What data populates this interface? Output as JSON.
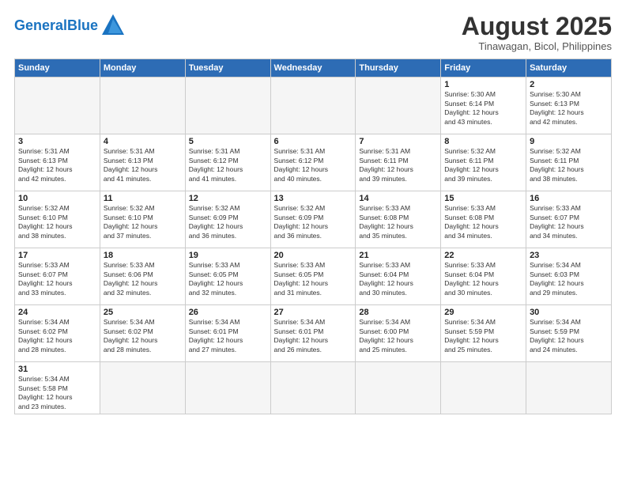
{
  "header": {
    "logo_general": "General",
    "logo_blue": "Blue",
    "cal_title": "August 2025",
    "cal_subtitle": "Tinawagan, Bicol, Philippines"
  },
  "weekdays": [
    "Sunday",
    "Monday",
    "Tuesday",
    "Wednesday",
    "Thursday",
    "Friday",
    "Saturday"
  ],
  "weeks": [
    [
      {
        "day": "",
        "info": ""
      },
      {
        "day": "",
        "info": ""
      },
      {
        "day": "",
        "info": ""
      },
      {
        "day": "",
        "info": ""
      },
      {
        "day": "",
        "info": ""
      },
      {
        "day": "1",
        "info": "Sunrise: 5:30 AM\nSunset: 6:14 PM\nDaylight: 12 hours\nand 43 minutes."
      },
      {
        "day": "2",
        "info": "Sunrise: 5:30 AM\nSunset: 6:13 PM\nDaylight: 12 hours\nand 42 minutes."
      }
    ],
    [
      {
        "day": "3",
        "info": "Sunrise: 5:31 AM\nSunset: 6:13 PM\nDaylight: 12 hours\nand 42 minutes."
      },
      {
        "day": "4",
        "info": "Sunrise: 5:31 AM\nSunset: 6:13 PM\nDaylight: 12 hours\nand 41 minutes."
      },
      {
        "day": "5",
        "info": "Sunrise: 5:31 AM\nSunset: 6:12 PM\nDaylight: 12 hours\nand 41 minutes."
      },
      {
        "day": "6",
        "info": "Sunrise: 5:31 AM\nSunset: 6:12 PM\nDaylight: 12 hours\nand 40 minutes."
      },
      {
        "day": "7",
        "info": "Sunrise: 5:31 AM\nSunset: 6:11 PM\nDaylight: 12 hours\nand 39 minutes."
      },
      {
        "day": "8",
        "info": "Sunrise: 5:32 AM\nSunset: 6:11 PM\nDaylight: 12 hours\nand 39 minutes."
      },
      {
        "day": "9",
        "info": "Sunrise: 5:32 AM\nSunset: 6:11 PM\nDaylight: 12 hours\nand 38 minutes."
      }
    ],
    [
      {
        "day": "10",
        "info": "Sunrise: 5:32 AM\nSunset: 6:10 PM\nDaylight: 12 hours\nand 38 minutes."
      },
      {
        "day": "11",
        "info": "Sunrise: 5:32 AM\nSunset: 6:10 PM\nDaylight: 12 hours\nand 37 minutes."
      },
      {
        "day": "12",
        "info": "Sunrise: 5:32 AM\nSunset: 6:09 PM\nDaylight: 12 hours\nand 36 minutes."
      },
      {
        "day": "13",
        "info": "Sunrise: 5:32 AM\nSunset: 6:09 PM\nDaylight: 12 hours\nand 36 minutes."
      },
      {
        "day": "14",
        "info": "Sunrise: 5:33 AM\nSunset: 6:08 PM\nDaylight: 12 hours\nand 35 minutes."
      },
      {
        "day": "15",
        "info": "Sunrise: 5:33 AM\nSunset: 6:08 PM\nDaylight: 12 hours\nand 34 minutes."
      },
      {
        "day": "16",
        "info": "Sunrise: 5:33 AM\nSunset: 6:07 PM\nDaylight: 12 hours\nand 34 minutes."
      }
    ],
    [
      {
        "day": "17",
        "info": "Sunrise: 5:33 AM\nSunset: 6:07 PM\nDaylight: 12 hours\nand 33 minutes."
      },
      {
        "day": "18",
        "info": "Sunrise: 5:33 AM\nSunset: 6:06 PM\nDaylight: 12 hours\nand 32 minutes."
      },
      {
        "day": "19",
        "info": "Sunrise: 5:33 AM\nSunset: 6:05 PM\nDaylight: 12 hours\nand 32 minutes."
      },
      {
        "day": "20",
        "info": "Sunrise: 5:33 AM\nSunset: 6:05 PM\nDaylight: 12 hours\nand 31 minutes."
      },
      {
        "day": "21",
        "info": "Sunrise: 5:33 AM\nSunset: 6:04 PM\nDaylight: 12 hours\nand 30 minutes."
      },
      {
        "day": "22",
        "info": "Sunrise: 5:33 AM\nSunset: 6:04 PM\nDaylight: 12 hours\nand 30 minutes."
      },
      {
        "day": "23",
        "info": "Sunrise: 5:34 AM\nSunset: 6:03 PM\nDaylight: 12 hours\nand 29 minutes."
      }
    ],
    [
      {
        "day": "24",
        "info": "Sunrise: 5:34 AM\nSunset: 6:02 PM\nDaylight: 12 hours\nand 28 minutes."
      },
      {
        "day": "25",
        "info": "Sunrise: 5:34 AM\nSunset: 6:02 PM\nDaylight: 12 hours\nand 28 minutes."
      },
      {
        "day": "26",
        "info": "Sunrise: 5:34 AM\nSunset: 6:01 PM\nDaylight: 12 hours\nand 27 minutes."
      },
      {
        "day": "27",
        "info": "Sunrise: 5:34 AM\nSunset: 6:01 PM\nDaylight: 12 hours\nand 26 minutes."
      },
      {
        "day": "28",
        "info": "Sunrise: 5:34 AM\nSunset: 6:00 PM\nDaylight: 12 hours\nand 25 minutes."
      },
      {
        "day": "29",
        "info": "Sunrise: 5:34 AM\nSunset: 5:59 PM\nDaylight: 12 hours\nand 25 minutes."
      },
      {
        "day": "30",
        "info": "Sunrise: 5:34 AM\nSunset: 5:59 PM\nDaylight: 12 hours\nand 24 minutes."
      }
    ],
    [
      {
        "day": "31",
        "info": "Sunrise: 5:34 AM\nSunset: 5:58 PM\nDaylight: 12 hours\nand 23 minutes."
      },
      {
        "day": "",
        "info": ""
      },
      {
        "day": "",
        "info": ""
      },
      {
        "day": "",
        "info": ""
      },
      {
        "day": "",
        "info": ""
      },
      {
        "day": "",
        "info": ""
      },
      {
        "day": "",
        "info": ""
      }
    ]
  ]
}
